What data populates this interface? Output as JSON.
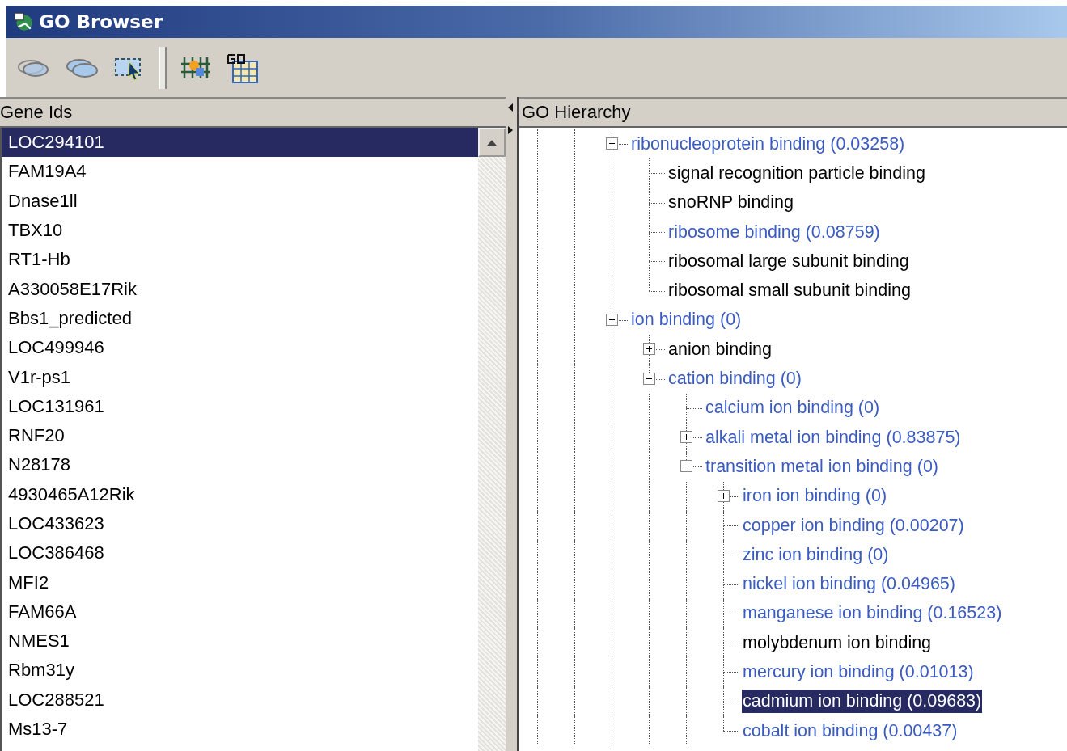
{
  "window": {
    "title": "GO Browser"
  },
  "gene_list": {
    "header": "Gene Ids",
    "items": [
      {
        "label": "LOC294101",
        "selected": true
      },
      {
        "label": "FAM19A4",
        "selected": false
      },
      {
        "label": "Dnase1ll",
        "selected": false
      },
      {
        "label": "TBX10",
        "selected": false
      },
      {
        "label": "RT1-Hb",
        "selected": false
      },
      {
        "label": "A330058E17Rik",
        "selected": false
      },
      {
        "label": "Bbs1_predicted",
        "selected": false
      },
      {
        "label": "LOC499946",
        "selected": false
      },
      {
        "label": "V1r-ps1",
        "selected": false
      },
      {
        "label": "LOC131961",
        "selected": false
      },
      {
        "label": "RNF20",
        "selected": false
      },
      {
        "label": "N28178",
        "selected": false
      },
      {
        "label": "4930465A12Rik",
        "selected": false
      },
      {
        "label": "LOC433623",
        "selected": false
      },
      {
        "label": "LOC386468",
        "selected": false
      },
      {
        "label": "MFI2",
        "selected": false
      },
      {
        "label": "FAM66A",
        "selected": false
      },
      {
        "label": "NMES1",
        "selected": false
      },
      {
        "label": "Rbm31y",
        "selected": false
      },
      {
        "label": "LOC288521",
        "selected": false
      },
      {
        "label": "Ms13-7",
        "selected": false
      }
    ]
  },
  "go_hierarchy": {
    "header": "GO Hierarchy",
    "tree": [
      {
        "label": "ribonucleoprotein binding (0.03258)",
        "enriched": true,
        "selected": false,
        "expanded": true,
        "children": [
          {
            "label": "signal recognition particle binding",
            "enriched": false,
            "selected": false
          },
          {
            "label": "snoRNP binding",
            "enriched": false,
            "selected": false
          },
          {
            "label": "ribosome binding (0.08759)",
            "enriched": true,
            "selected": false
          },
          {
            "label": "ribosomal large subunit binding",
            "enriched": false,
            "selected": false
          },
          {
            "label": "ribosomal small subunit binding",
            "enriched": false,
            "selected": false
          }
        ]
      },
      {
        "label": "ion binding (0)",
        "enriched": true,
        "selected": false,
        "expanded": true,
        "children": [
          {
            "label": "anion binding",
            "enriched": false,
            "selected": false,
            "expanded": false
          },
          {
            "label": "cation binding (0)",
            "enriched": true,
            "selected": false,
            "expanded": true,
            "children": [
              {
                "label": "calcium ion binding (0)",
                "enriched": true,
                "selected": false
              },
              {
                "label": "alkali metal ion binding (0.83875)",
                "enriched": true,
                "selected": false,
                "expanded": false
              },
              {
                "label": "transition metal ion binding (0)",
                "enriched": true,
                "selected": false,
                "expanded": true,
                "children": [
                  {
                    "label": "iron ion binding (0)",
                    "enriched": true,
                    "selected": false,
                    "expanded": false
                  },
                  {
                    "label": "copper ion binding (0.00207)",
                    "enriched": true,
                    "selected": false
                  },
                  {
                    "label": "zinc ion binding (0)",
                    "enriched": true,
                    "selected": false
                  },
                  {
                    "label": "nickel ion binding (0.04965)",
                    "enriched": true,
                    "selected": false
                  },
                  {
                    "label": "manganese ion binding (0.16523)",
                    "enriched": true,
                    "selected": false
                  },
                  {
                    "label": "molybdenum ion binding",
                    "enriched": false,
                    "selected": false
                  },
                  {
                    "label": "mercury ion binding (0.01013)",
                    "enriched": true,
                    "selected": false
                  },
                  {
                    "label": "cadmium ion binding (0.09683)",
                    "enriched": true,
                    "selected": true
                  },
                  {
                    "label": "cobalt ion binding (0.00437)",
                    "enriched": true,
                    "selected": false
                  }
                ]
              }
            ]
          }
        ]
      }
    ]
  }
}
